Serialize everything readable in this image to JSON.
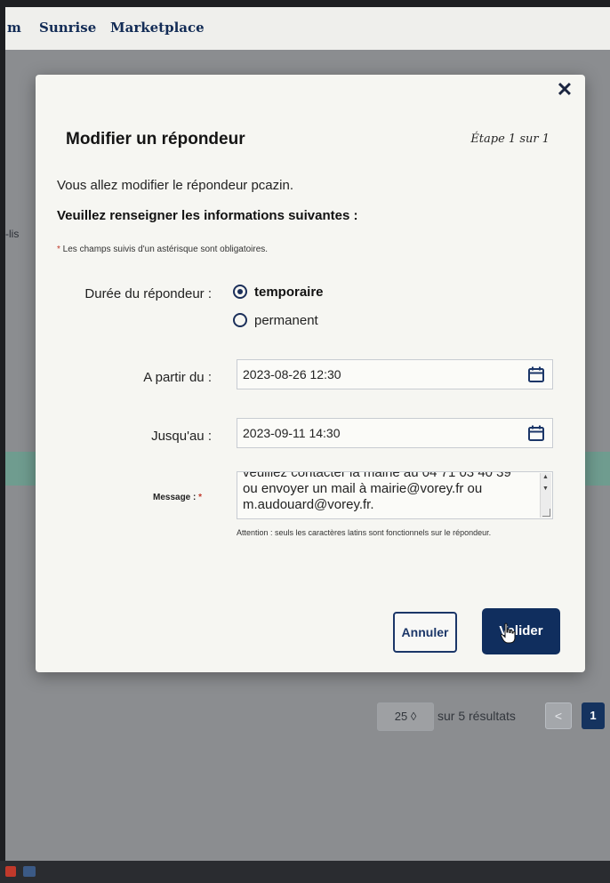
{
  "topbar": {
    "truncated_item": "m",
    "items": [
      "Sunrise",
      "Marketplace"
    ]
  },
  "background": {
    "left_edge_text": "-lis",
    "pagination": {
      "page_size": "25 ◊",
      "results_text": "sur 5 résultats",
      "prev": "<",
      "current_page": "1"
    }
  },
  "modal": {
    "title": "Modifier un répondeur",
    "step": "Étape 1 sur 1",
    "intro": "Vous allez modifier le répondeur pcazin.",
    "required_heading": "Veuillez renseigner les informations suivantes :",
    "required_note_star": "*",
    "required_note": " Les champs suivis d'un astérisque sont obligatoires.",
    "duration": {
      "label": "Durée du répondeur :",
      "options": [
        "temporaire",
        "permanent"
      ],
      "selected": "temporaire"
    },
    "from": {
      "label": "A partir du :",
      "value": "2023-08-26 12:30"
    },
    "until": {
      "label": "Jusqu'au :",
      "value": "2023-09-11 14:30"
    },
    "message": {
      "label": "Message :",
      "label_star": "*",
      "lines": [
        "veuillez contacter la mairie au 04 71 03 40 39",
        "ou envoyer un mail à mairie@vorey.fr ou",
        "m.audouard@vorey.fr."
      ],
      "warning": "Attention : seuls les caractères latins sont fonctionnels sur le répondeur."
    },
    "buttons": {
      "cancel": "Annuler",
      "validate": "Valider"
    },
    "close": "✕"
  },
  "colors": {
    "primary": "#102e5e",
    "overlay": "#6e7176",
    "modal_bg": "#f6f6f2"
  }
}
